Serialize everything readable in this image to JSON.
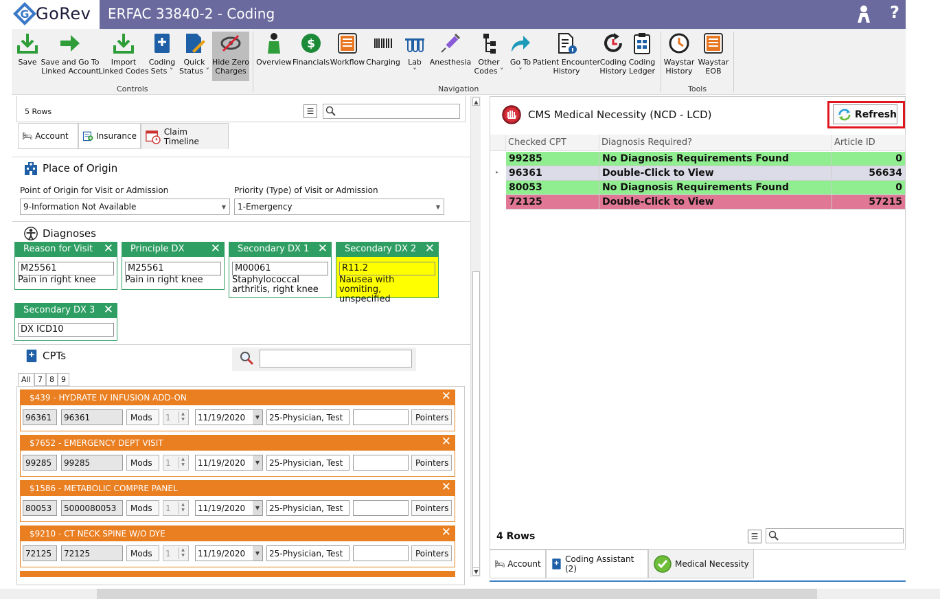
{
  "app": {
    "logo_text": "GoRev",
    "window_title": "ERFAC 33840-2 - Coding",
    "help": "?"
  },
  "ribbon": {
    "buttons": [
      {
        "label": "Save"
      },
      {
        "label": "Save and Go To\nLinked Account"
      },
      {
        "label": "Import\nLinked Codes"
      },
      {
        "label": "Coding\nSets ˅"
      },
      {
        "label": "Quick\nStatus ˅"
      },
      {
        "label": "Hide Zero\nCharges"
      },
      {
        "label": "Overview"
      },
      {
        "label": "Financials"
      },
      {
        "label": "Workflow"
      },
      {
        "label": "Charging"
      },
      {
        "label": "Lab\n˅"
      },
      {
        "label": "Anesthesia"
      },
      {
        "label": "Other\nCodes ˅"
      },
      {
        "label": "Go To\n˅"
      },
      {
        "label": "Patient Encounter\nHistory"
      },
      {
        "label": "Coding\nHistory"
      },
      {
        "label": "Coding\nLedger"
      },
      {
        "label": "Waystar\nHistory"
      },
      {
        "label": "Waystar\nEOB"
      }
    ],
    "groups": {
      "controls": "Controls",
      "navigation": "Navigation",
      "tools": "Tools"
    }
  },
  "left": {
    "rows_label": "5 Rows",
    "tabs": {
      "account": "Account",
      "insurance": "Insurance",
      "claim_timeline": "Claim Timeline"
    },
    "place_of_origin": {
      "title": "Place of Origin",
      "point_label": "Point of Origin for Visit or Admission",
      "point_value": "9-Information Not Available",
      "priority_label": "Priority (Type) of Visit or Admission",
      "priority_value": "1-Emergency"
    },
    "diagnoses": {
      "title": "Diagnoses",
      "cards": [
        {
          "header": "Reason for Visit",
          "code": "M25561",
          "desc": "Pain in right knee"
        },
        {
          "header": "Principle DX",
          "code": "M25561",
          "desc": "Pain in right knee"
        },
        {
          "header": "Secondary DX 1",
          "code": "M00061",
          "desc": "Staphylococcal arthritis, right knee"
        },
        {
          "header": "Secondary DX 2",
          "code": "R11.2",
          "desc": "Nausea with vomiting, unspecified"
        },
        {
          "header": "Secondary DX 3",
          "code": "DX ICD10",
          "desc": ""
        }
      ]
    },
    "cpts": {
      "title": "CPTs",
      "tabs": [
        "All",
        "7",
        "8",
        "9"
      ],
      "items": [
        {
          "title": "$439 - HYDRATE IV INFUSION ADD-ON",
          "code1": "96361",
          "code2": "96361",
          "mods": "Mods",
          "qty": "1",
          "date": "11/19/2020",
          "physician": "25-Physician, Test",
          "pointers": "Pointers"
        },
        {
          "title": "$7652 - EMERGENCY DEPT VISIT",
          "code1": "99285",
          "code2": "99285",
          "mods": "Mods",
          "qty": "1",
          "date": "11/19/2020",
          "physician": "25-Physician, Test",
          "pointers": "Pointers"
        },
        {
          "title": "$1586 - METABOLIC COMPRE PANEL",
          "code1": "80053",
          "code2": "5000080053",
          "mods": "Mods",
          "qty": "1",
          "date": "11/19/2020",
          "physician": "25-Physician, Test",
          "pointers": "Pointers"
        },
        {
          "title": "$9210 - CT NECK SPINE W/O DYE",
          "code1": "72125",
          "code2": "72125",
          "mods": "Mods",
          "qty": "1",
          "date": "11/19/2020",
          "physician": "25-Physician, Test",
          "pointers": "Pointers"
        }
      ]
    }
  },
  "right": {
    "title": "CMS Medical Necessity (NCD - LCD)",
    "refresh": "Refresh",
    "columns": [
      "Checked CPT",
      "Diagnosis Required?",
      "Article ID"
    ],
    "rows": [
      {
        "cpt": "99285",
        "dx": "No Diagnosis Requirements Found",
        "article": "0",
        "color": "green"
      },
      {
        "cpt": "96361",
        "dx": "Double-Click to View",
        "article": "56634",
        "color": "lavender"
      },
      {
        "cpt": "80053",
        "dx": "No Diagnosis Requirements Found",
        "article": "0",
        "color": "green"
      },
      {
        "cpt": "72125",
        "dx": "Double-Click to View",
        "article": "57215",
        "color": "red"
      }
    ],
    "rows_label": "4 Rows",
    "bottom_tabs": {
      "account": "Account",
      "coding_assistant": "Coding Assistant (2)",
      "medical_necessity": "Medical Necessity"
    }
  }
}
